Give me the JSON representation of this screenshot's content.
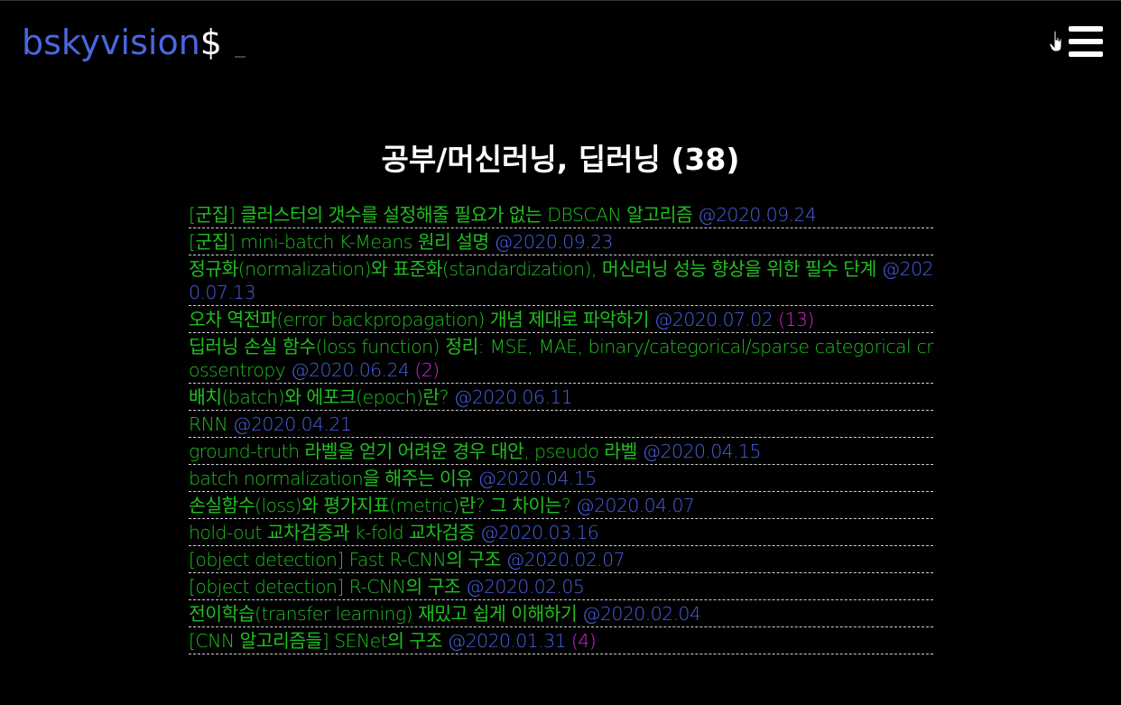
{
  "header": {
    "logo_name": "bskyvision",
    "logo_symbol": "$",
    "cursor": "_"
  },
  "page": {
    "title": "공부/머신러닝, 딥러닝 (38)"
  },
  "colors": {
    "background": "#000000",
    "logo": "#4a67e0",
    "post_title": "#1fbf1f",
    "post_date": "#4a5fe0",
    "comment_count": "#e020e0",
    "separator": "#cfcfcf"
  },
  "posts": [
    {
      "title": "[군집] 클러스터의 갯수를 설정해줄 필요가 없는 DBSCAN 알고리즘",
      "date": "@2020.09.24",
      "count": ""
    },
    {
      "title": "[군집] mini-batch K-Means 원리 설명",
      "date": "@2020.09.23",
      "count": ""
    },
    {
      "title": "정규화(normalization)와 표준화(standardization), 머신러닝 성능 향상을 위한 필수 단계",
      "date": "@2020.07.13",
      "count": ""
    },
    {
      "title": "오차 역전파(error backpropagation) 개념 제대로 파악하기",
      "date": "@2020.07.02",
      "count": "(13)"
    },
    {
      "title": "딥러닝 손실 함수(loss function) 정리: MSE, MAE, binary/categorical/sparse categorical crossentropy",
      "date": "@2020.06.24",
      "count": "(2)"
    },
    {
      "title": "배치(batch)와 에포크(epoch)란?",
      "date": "@2020.06.11",
      "count": ""
    },
    {
      "title": "RNN",
      "date": "@2020.04.21",
      "count": ""
    },
    {
      "title": "ground-truth 라벨을 얻기 어려운 경우 대안, pseudo 라벨",
      "date": "@2020.04.15",
      "count": ""
    },
    {
      "title": "batch normalization을 해주는 이유",
      "date": "@2020.04.15",
      "count": ""
    },
    {
      "title": "손실함수(loss)와 평가지표(metric)란? 그 차이는?",
      "date": "@2020.04.07",
      "count": ""
    },
    {
      "title": "hold-out 교차검증과 k-fold 교차검증",
      "date": "@2020.03.16",
      "count": ""
    },
    {
      "title": "[object detection] Fast R-CNN의 구조",
      "date": "@2020.02.07",
      "count": ""
    },
    {
      "title": "[object detection] R-CNN의 구조",
      "date": "@2020.02.05",
      "count": ""
    },
    {
      "title": "전이학습(transfer learning) 재밌고 쉽게 이해하기",
      "date": "@2020.02.04",
      "count": ""
    },
    {
      "title": "[CNN 알고리즘들] SENet의 구조",
      "date": "@2020.01.31",
      "count": "(4)"
    }
  ]
}
